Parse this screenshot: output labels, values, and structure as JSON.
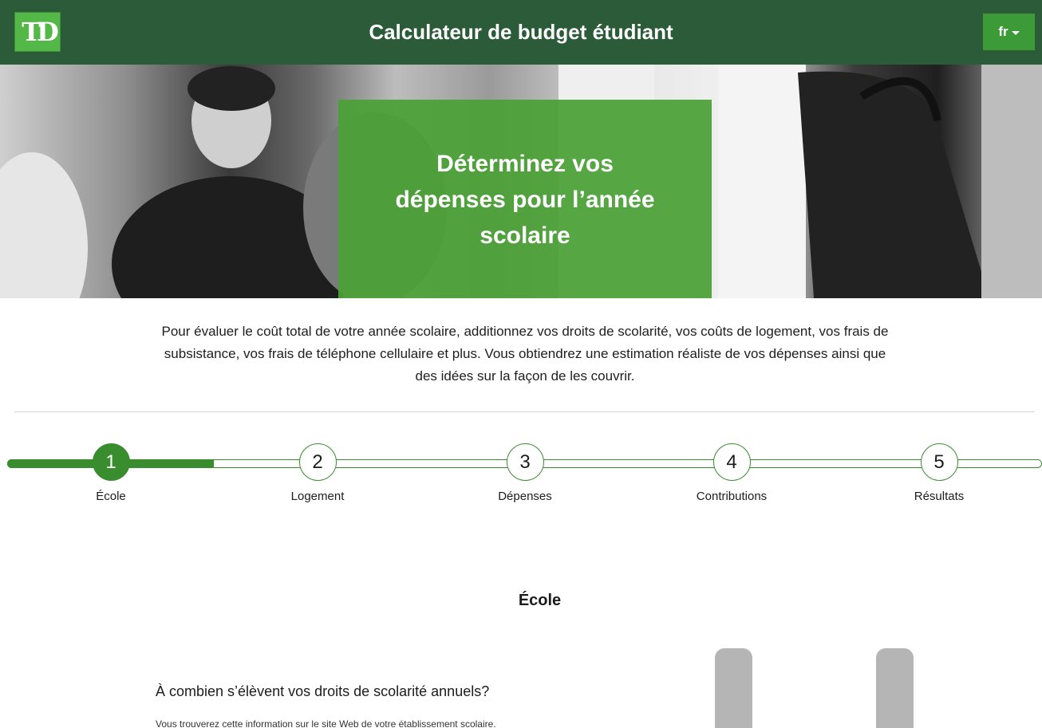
{
  "header": {
    "logo_text": "TD",
    "title": "Calculateur de budget étudiant",
    "language_label": "fr"
  },
  "hero": {
    "heading": "Déterminez vos dépenses pour l’année scolaire"
  },
  "intro": {
    "text": "Pour évaluer le coût total de votre année scolaire, additionnez vos droits de scolarité, vos coûts de logement, vos frais de subsistance, vos frais de téléphone cellulaire et plus. Vous obtiendrez une estimation réaliste de vos dépenses ainsi que des idées sur la façon de les couvrir."
  },
  "stepper": {
    "current_step": 1,
    "progress_fraction": 0.2,
    "steps": [
      {
        "number": "1",
        "label": "École"
      },
      {
        "number": "2",
        "label": "Logement"
      },
      {
        "number": "3",
        "label": "Dépenses"
      },
      {
        "number": "4",
        "label": "Contributions"
      },
      {
        "number": "5",
        "label": "Résultats"
      }
    ]
  },
  "section": {
    "title": "École",
    "question": "À combien s’élèvent vos droits de scolarité annuels?",
    "helper": "Vous trouverez cette information sur le site Web de votre établissement scolaire."
  },
  "colors": {
    "header_bg": "#2c5b39",
    "brand_green": "#54b848",
    "accent_green": "#3a8d2f",
    "hero_box": "#4aa036"
  }
}
